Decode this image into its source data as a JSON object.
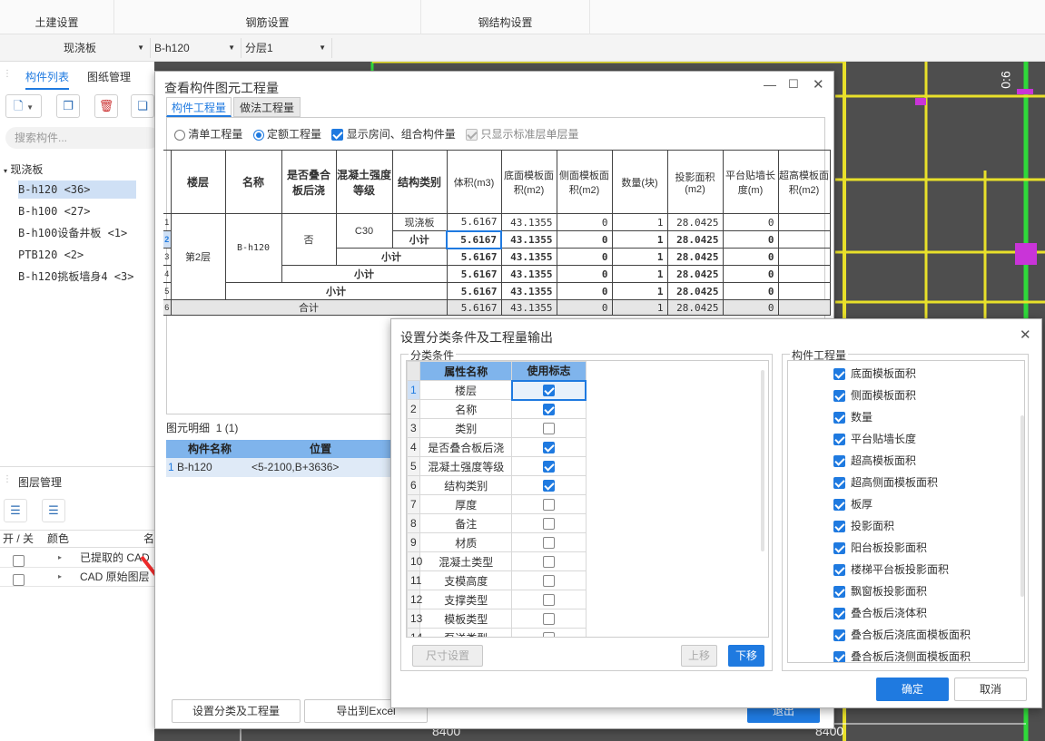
{
  "top_menu": [
    "土建设置",
    "钢筋设置",
    "钢结构设置"
  ],
  "toolbar2": {
    "type_select": "现浇板",
    "component_select": "B-h120",
    "layer_select": "分层1"
  },
  "left_panel": {
    "tab_component_list": "构件列表",
    "tab_drawing_mgmt": "图纸管理",
    "search_placeholder": "搜索构件...",
    "tree_root": "现浇板",
    "tree_items": [
      "B-h120 <36>",
      "B-h100 <27>",
      "B-h100设备井板 <1>",
      "PTB120 <2>",
      "B-h120挑板墙身4 <3>"
    ],
    "layer_mgmt_title": "图层管理",
    "layer_headers": [
      "开 / 关",
      "颜色",
      "名"
    ],
    "layers": [
      "已提取的 CAD",
      "CAD 原始图层"
    ]
  },
  "canvas": {
    "dim_labels": [
      "8400",
      "8400"
    ],
    "side_label": "0:6"
  },
  "dialog1": {
    "title": "查看构件图元工程量",
    "tabs": [
      "构件工程量",
      "做法工程量"
    ],
    "radio_list": "清单工程量",
    "radio_quota": "定额工程量",
    "check_show_rooms": "显示房间、组合构件量",
    "check_std_layer": "只显示标准层单层量",
    "headers": [
      "楼层",
      "名称",
      "是否叠合板后浇",
      "混凝土强度等级",
      "结构类别",
      "体积(m3)",
      "底面模板面积(m2)",
      "侧面模板面积(m2)",
      "数量(块)",
      "投影面积(m2)",
      "平台贴墙长度(m)",
      "超高模板面积(m2)"
    ],
    "row_nums": [
      "1",
      "2",
      "3",
      "4",
      "5",
      "6"
    ],
    "floor": "第2层",
    "name": "B-h120",
    "is_laminated": "否",
    "grade": "C30",
    "struct": "现浇板",
    "subtotal": "小计",
    "total": "合计",
    "values": {
      "volume": "5.6167",
      "bottom_area": "43.1355",
      "side_area": "0",
      "count": "1",
      "proj_area": "28.0425",
      "wall_len": "0"
    },
    "detail_title": "图元明细",
    "detail_count": "1 (1)",
    "detail_headers": [
      "构件名称",
      "位置"
    ],
    "detail_row": {
      "idx": "1",
      "name": "B-h120",
      "pos": "<5-2100,B+3636>"
    },
    "btn_set_classify": "设置分类及工程量",
    "btn_export": "导出到Excel",
    "btn_exit": "退出"
  },
  "dialog2": {
    "title": "设置分类条件及工程量输出",
    "group_conditions": "分类条件",
    "group_quantities": "构件工程量",
    "col_attr": "属性名称",
    "col_flag": "使用标志",
    "conditions": [
      {
        "idx": "1",
        "name": "楼层",
        "on": true
      },
      {
        "idx": "2",
        "name": "名称",
        "on": true
      },
      {
        "idx": "3",
        "name": "类别",
        "on": false
      },
      {
        "idx": "4",
        "name": "是否叠合板后浇",
        "on": true
      },
      {
        "idx": "5",
        "name": "混凝土强度等级",
        "on": true
      },
      {
        "idx": "6",
        "name": "结构类别",
        "on": true
      },
      {
        "idx": "7",
        "name": "厚度",
        "on": false
      },
      {
        "idx": "8",
        "name": "备注",
        "on": false
      },
      {
        "idx": "9",
        "name": "材质",
        "on": false
      },
      {
        "idx": "10",
        "name": "混凝土类型",
        "on": false
      },
      {
        "idx": "11",
        "name": "支模高度",
        "on": false
      },
      {
        "idx": "12",
        "name": "支撑类型",
        "on": false
      },
      {
        "idx": "13",
        "name": "模板类型",
        "on": false
      },
      {
        "idx": "14",
        "name": "泵送类型",
        "on": false
      }
    ],
    "quantities": [
      "底面模板面积",
      "侧面模板面积",
      "数量",
      "平台贴墙长度",
      "超高模板面积",
      "超高侧面模板面积",
      "板厚",
      "投影面积",
      "阳台板投影面积",
      "楼梯平台板投影面积",
      "飘窗板投影面积",
      "叠合板后浇体积",
      "叠合板后浇底面模板面积",
      "叠合板后浇侧面模板面积"
    ],
    "btn_size": "尺寸设置",
    "btn_up": "上移",
    "btn_down": "下移",
    "btn_ok": "确定",
    "btn_cancel": "取消"
  }
}
